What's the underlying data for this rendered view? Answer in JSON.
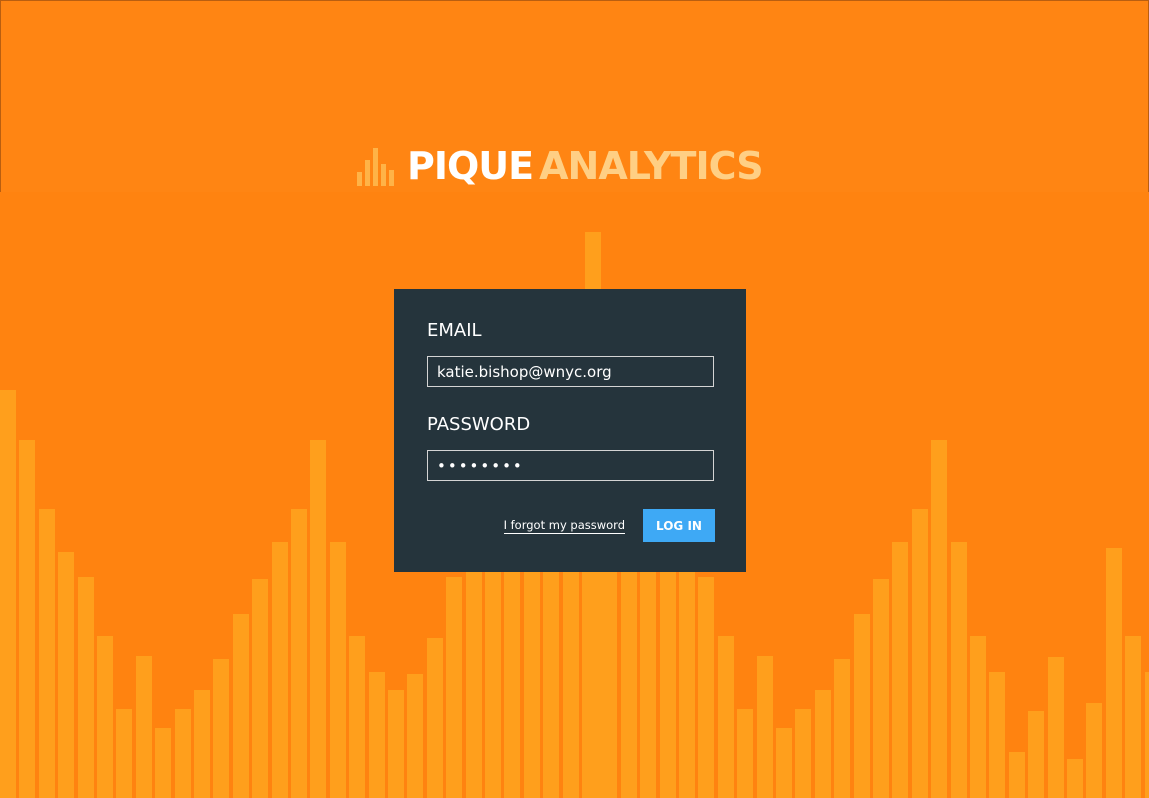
{
  "brand": {
    "word1": "PIQUE",
    "word2": "ANALYTICS",
    "icon": "bar-chart-icon",
    "colors": {
      "background": "#ff8310",
      "bars": "#ff9f1c",
      "word1": "#ffffff",
      "word2": "#ffcf84"
    }
  },
  "login": {
    "email_label": "EMAIL",
    "email_value": "katie.bishop@wnyc.org",
    "password_label": "PASSWORD",
    "password_value": "••••••••",
    "forgot_label": "I forgot my password",
    "submit_label": "LOG IN",
    "colors": {
      "card": "#25343c",
      "button": "#3ea9f5"
    }
  }
}
